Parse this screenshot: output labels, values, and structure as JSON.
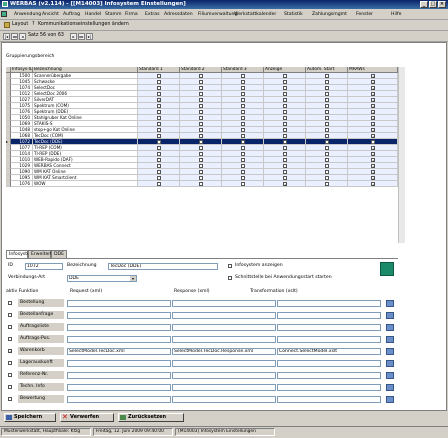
{
  "window": {
    "title": "WERBAS (v2.114) - [[M14003] Infosystem Einstellungen]"
  },
  "menu": [
    "Anwendung",
    "Ansicht",
    "Auftrag",
    "Handel",
    "Stamm",
    "Firma",
    "Extras",
    "Adressdaten",
    "Filiumverwaltung",
    "Werkstattkalender",
    "Statistik",
    "Zahlungsmgmt",
    "Fenster",
    "Hilfe"
  ],
  "toolbar": {
    "layout_label": "Layout",
    "comm_label": "Kommunikationseinstellungen ändern",
    "record_label": "Satz 56 von 63"
  },
  "section": {
    "title": "Gruppierungsbereich"
  },
  "grid": {
    "headers": [
      "Infosys-ID",
      "Bezeichnung",
      "Standard 1",
      "Standard 2",
      "Standard 3",
      "Anzeige",
      "Autom. Start",
      "MRAWs"
    ],
    "rows": [
      {
        "id": "1500",
        "name": "Scannerübergabe",
        "c": [
          0,
          0,
          0,
          0,
          0,
          1
        ]
      },
      {
        "id": "1045",
        "name": "Schwacke",
        "c": [
          0,
          0,
          0,
          0,
          0,
          1
        ]
      },
      {
        "id": "1074",
        "name": "SelectDoc",
        "c": [
          0,
          0,
          0,
          0,
          0,
          1
        ]
      },
      {
        "id": "1012",
        "name": "SelectDoc 2006",
        "c": [
          0,
          0,
          0,
          0,
          0,
          1
        ]
      },
      {
        "id": "1027",
        "name": "SilverDAT",
        "c": [
          1,
          0,
          0,
          0,
          0,
          1
        ]
      },
      {
        "id": "1075",
        "name": "Spektrum (COM)",
        "c": [
          0,
          0,
          0,
          0,
          0,
          1
        ]
      },
      {
        "id": "1076",
        "name": "Spektrum (DDE)",
        "c": [
          0,
          0,
          0,
          0,
          0,
          1
        ]
      },
      {
        "id": "1050",
        "name": "Stahlgruber Kat Online",
        "c": [
          0,
          0,
          0,
          0,
          0,
          1
        ]
      },
      {
        "id": "1069",
        "name": "STAKIS-S",
        "c": [
          0,
          0,
          0,
          0,
          0,
          1
        ]
      },
      {
        "id": "1048",
        "name": "stop+go Kat Online",
        "c": [
          0,
          0,
          0,
          0,
          0,
          1
        ]
      },
      {
        "id": "1068",
        "name": "TecDoc (COM)",
        "c": [
          0,
          0,
          0,
          0,
          0,
          1
        ]
      },
      {
        "id": "1072",
        "name": "TecDoc (DDE)",
        "c": [
          1,
          0,
          0,
          0,
          0,
          1
        ],
        "selected": true
      },
      {
        "id": "1077",
        "name": "TI-REP (COM)",
        "c": [
          0,
          0,
          0,
          0,
          0,
          1
        ]
      },
      {
        "id": "1014",
        "name": "TI-REP (DDE)",
        "c": [
          0,
          0,
          0,
          0,
          0,
          1
        ]
      },
      {
        "id": "1010",
        "name": "WEB-Rapido (DAF)",
        "c": [
          0,
          0,
          0,
          0,
          0,
          1
        ]
      },
      {
        "id": "1029",
        "name": "WERBAS Connect",
        "c": [
          0,
          0,
          0,
          0,
          0,
          1
        ]
      },
      {
        "id": "1090",
        "name": "WM KAT Online",
        "c": [
          0,
          0,
          0,
          0,
          0,
          1
        ]
      },
      {
        "id": "1095",
        "name": "WM KAT Smartclient",
        "c": [
          0,
          0,
          0,
          0,
          0,
          1
        ]
      },
      {
        "id": "1076",
        "name": "WOW",
        "c": [
          0,
          0,
          0,
          1,
          0,
          1
        ]
      }
    ]
  },
  "tabs": [
    "Infosystem",
    "Erweitert",
    "DDE"
  ],
  "detail": {
    "id_label": "ID",
    "id_value": "1072",
    "bez_label": "Bezeichnung",
    "bez_value": "TecDoc (DDE)",
    "vart_label": "Verbindungs-Art",
    "vart_value": "DDE",
    "cb1_label": "Infosystem anzeigen",
    "cb2_label": "Schnittstelle bei Anwendungsstart starten"
  },
  "functions": {
    "headers": [
      "aktiv Funktion",
      "Request (xml)",
      "Response (xml)",
      "Transformation (xslt)"
    ],
    "rows": [
      {
        "name": "Bestellung",
        "checked": false,
        "req": "",
        "resp": "",
        "trans": ""
      },
      {
        "name": "Bestellanfrage",
        "checked": false,
        "req": "",
        "resp": "",
        "trans": ""
      },
      {
        "name": "Auftragsliste",
        "checked": false,
        "req": "",
        "resp": "",
        "trans": ""
      },
      {
        "name": "Auftrags-Pos.",
        "checked": false,
        "req": "",
        "resp": "",
        "trans": ""
      },
      {
        "name": "Warenkorb",
        "checked": true,
        "req": "SelectModel.TecDoc.xml",
        "resp": "SelectModel.TecDoc.Response.xml",
        "trans": "Connect.SelectModel.xslt"
      },
      {
        "name": "Lagerauskunft",
        "checked": false,
        "req": "",
        "resp": "",
        "trans": ""
      },
      {
        "name": "Referenz-Nr.",
        "checked": false,
        "req": "",
        "resp": "",
        "trans": ""
      },
      {
        "name": "Techn. Info",
        "checked": false,
        "req": "",
        "resp": "",
        "trans": ""
      },
      {
        "name": "Bewertung",
        "checked": false,
        "req": "",
        "resp": "",
        "trans": ""
      }
    ]
  },
  "buttons": {
    "save": "Speichern",
    "discard": "Verwerfen",
    "back": "Zurücksetzen"
  },
  "status": [
    "Musterwerkstatt, Hauptfiliale: Kfzg",
    "Freitag, 12. Juni 2009 09:40:00",
    "[M14003] Infosystem Einstellungen"
  ]
}
